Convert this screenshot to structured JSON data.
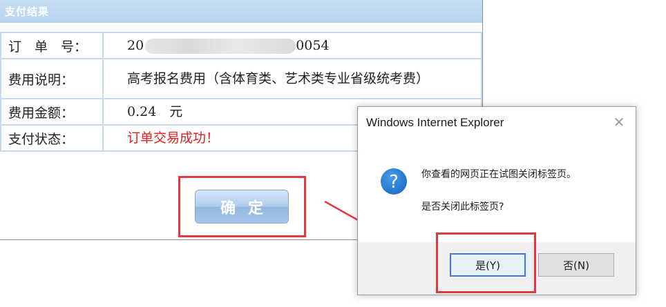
{
  "panel": {
    "title": "支付结果",
    "rows": [
      {
        "label": "订　单　号：",
        "value_prefix": "20",
        "value_suffix": "0054"
      },
      {
        "label": "费用说明：",
        "value": "高考报名费用（含体育类、艺术类专业省级统考费）"
      },
      {
        "label": "费用金额：",
        "value": "0.24　元"
      },
      {
        "label": "支付状态：",
        "value": "订单交易成功！"
      }
    ],
    "confirm_label": "确定"
  },
  "dialog": {
    "title": "Windows Internet Explorer",
    "close_glyph": "✕",
    "message": "你查看的网页正在试图关闭标签页。",
    "question": "是否关闭此标签页?",
    "yes_label": "是(Y)",
    "no_label": "否(N)"
  },
  "colors": {
    "highlight_red": "#e2383f",
    "success_text": "#e0201d",
    "header_blue": "#b7d3ef",
    "question_icon_blue": "#1c6fc9"
  },
  "icons": {
    "dialog_icon": "question-icon",
    "close_icon": "close-icon"
  }
}
